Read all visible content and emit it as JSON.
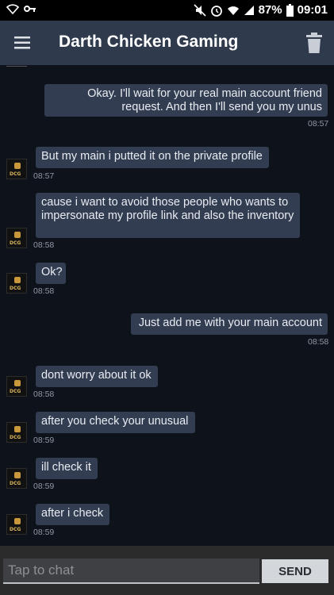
{
  "status_bar": {
    "battery_percent": "87%",
    "time": "09:01",
    "icons": [
      "wifi-icon",
      "key-icon",
      "mute-icon",
      "alarm-icon",
      "wifi-signal-icon",
      "cell-signal-icon",
      "battery-icon"
    ]
  },
  "header": {
    "title": "Darth Chicken Gaming",
    "menu_icon": "hamburger-menu-icon",
    "delete_icon": "trash-icon"
  },
  "messages": [
    {
      "direction": "out",
      "text": "Okay. I'll wait for your real main account friend request. And then I'll send you my unus",
      "time": "08:57"
    },
    {
      "direction": "in",
      "text": "But my main i putted it on the private profile",
      "time": "08:57"
    },
    {
      "direction": "in",
      "text": "cause i want to avoid those people who wants to impersonate my profile link and also the inventory",
      "time": "08:58"
    },
    {
      "direction": "in",
      "text": "Ok?",
      "time": "08:58"
    },
    {
      "direction": "out",
      "text": "Just add me with your main account",
      "time": "08:58"
    },
    {
      "direction": "in",
      "text": "dont worry about it ok",
      "time": "08:58"
    },
    {
      "direction": "in",
      "text": "after you check your unusual",
      "time": "08:59"
    },
    {
      "direction": "in",
      "text": "ill check it",
      "time": "08:59"
    },
    {
      "direction": "in",
      "text": "after i check",
      "time": "08:59"
    }
  ],
  "avatar_label": "DCG",
  "composer": {
    "placeholder": "Tap to chat",
    "send_label": "SEND"
  },
  "colors": {
    "app_bar": "#2f3a4c",
    "background": "#0e131b",
    "bubble": "#323d52"
  }
}
